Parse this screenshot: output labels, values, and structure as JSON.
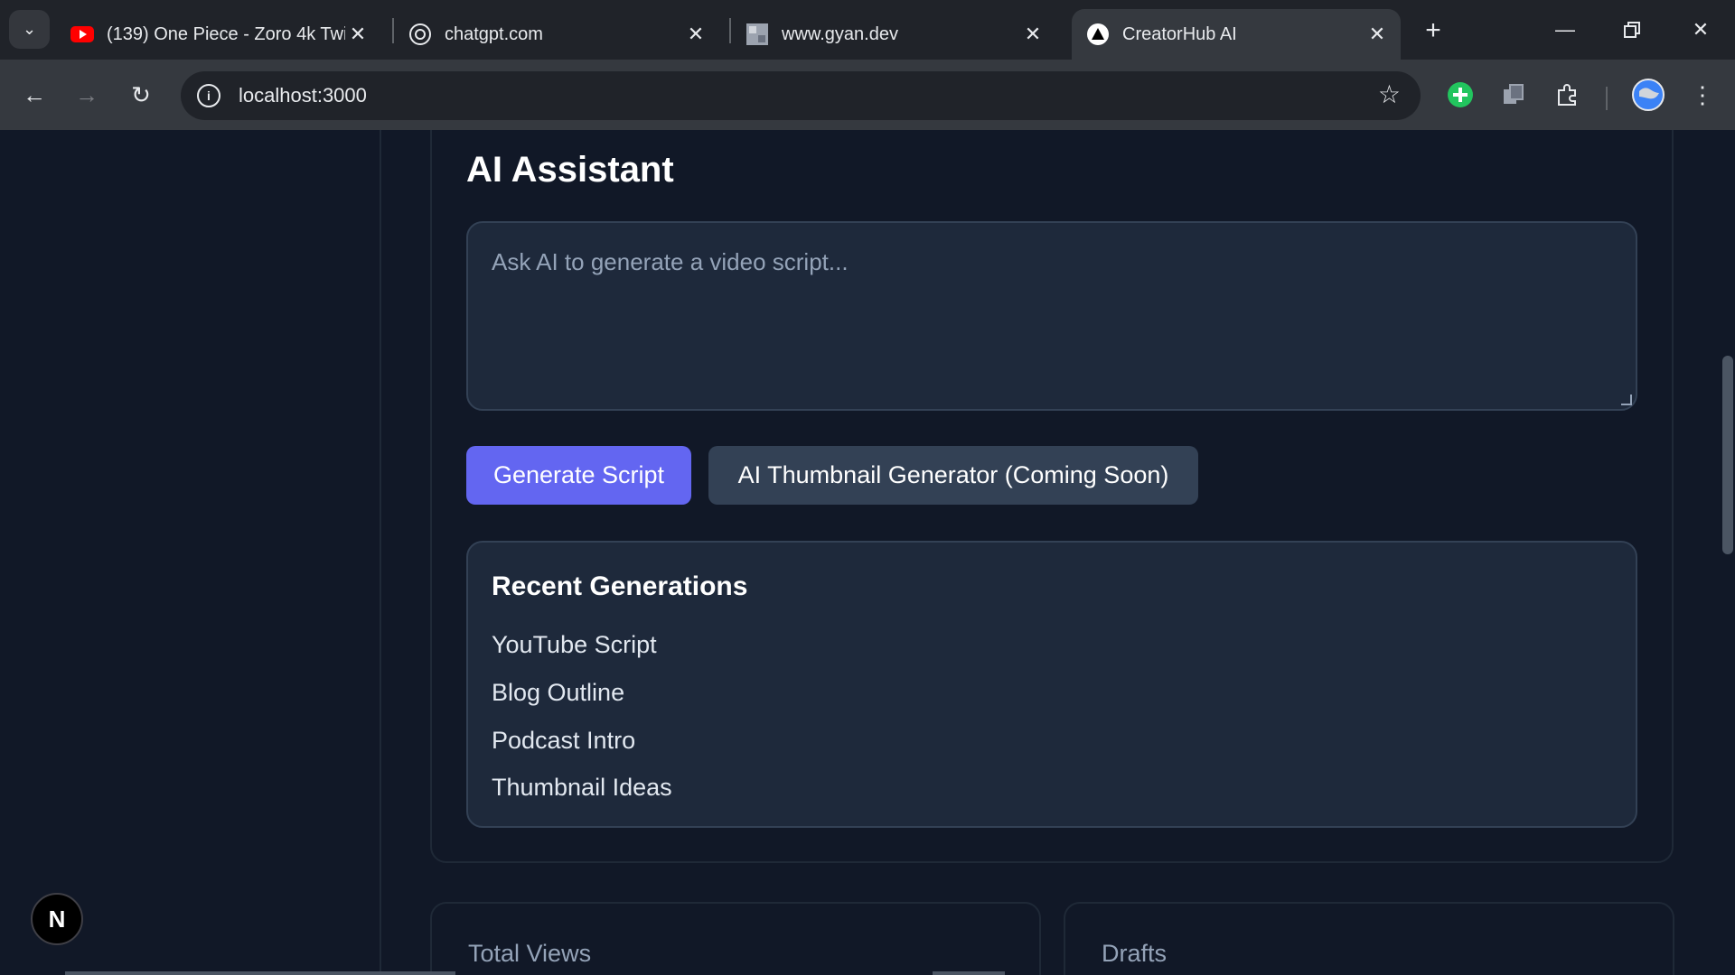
{
  "browser": {
    "tabs": [
      {
        "title": "(139) One Piece - Zoro 4k Twi",
        "favicon": "youtube-icon",
        "active": false
      },
      {
        "title": "chatgpt.com",
        "favicon": "chatgpt-icon",
        "active": false
      },
      {
        "title": "www.gyan.dev",
        "favicon": "site-thumbnail-icon",
        "active": false
      },
      {
        "title": "CreatorHub AI",
        "favicon": "triangle-logo-icon",
        "active": true
      }
    ],
    "url": "localhost:3000"
  },
  "assistant": {
    "title": "AI Assistant",
    "prompt_placeholder": "Ask AI to generate a video script...",
    "generate_label": "Generate Script",
    "thumbnail_label": "AI Thumbnail Generator (Coming Soon)"
  },
  "recent": {
    "title": "Recent Generations",
    "items": [
      "YouTube Script",
      "Blog Outline",
      "Podcast Intro",
      "Thumbnail Ideas"
    ]
  },
  "stats": [
    {
      "label": "Total Views"
    },
    {
      "label": "Drafts"
    }
  ],
  "badge": {
    "letter": "N"
  },
  "colors": {
    "accent": "#6366f1",
    "surface": "#1e293b",
    "background": "#111827"
  }
}
